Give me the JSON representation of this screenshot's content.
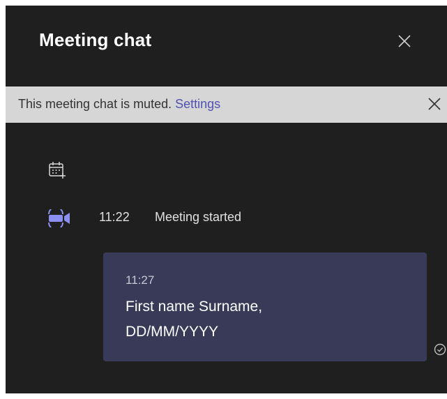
{
  "header": {
    "title": "Meeting chat",
    "close_icon": "close-icon"
  },
  "banner": {
    "text": "This meeting chat is muted.",
    "link": "Settings",
    "close_icon": "close-icon"
  },
  "events": {
    "calendar_icon": "calendar-add-icon",
    "video_icon": "video-camera-icon",
    "time": "11:22",
    "label": "Meeting started"
  },
  "message": {
    "time": "11:27",
    "line1": "First name Surname,",
    "line2": "DD/MM/YYYY",
    "status_icon": "read-receipt-icon"
  },
  "colors": {
    "panel_bg": "#1f1f1f",
    "banner_bg": "#d6d6d6",
    "link": "#4f52b2",
    "bubble_bg": "#383a58",
    "accent": "#8b8ff0"
  }
}
